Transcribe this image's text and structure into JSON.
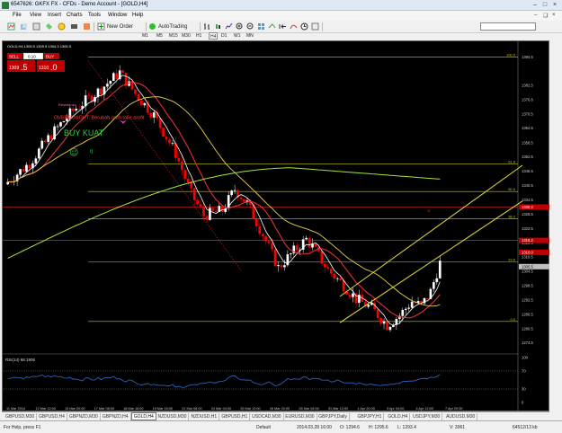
{
  "window": {
    "title": "6547626: GKFX FX - CFDs - Demo Account - [GOLD,H4]"
  },
  "menu": [
    "File",
    "View",
    "Insert",
    "Charts",
    "Tools",
    "Window",
    "Help"
  ],
  "toolbar": {
    "new_order": "New Order",
    "autotrading": "AutoTrading",
    "timeframes": [
      "M1",
      "M5",
      "M15",
      "M30",
      "H1",
      "H4",
      "D1",
      "W1",
      "MN"
    ]
  },
  "chart": {
    "symbol_line": "GOLD,H4 1305.5 1309.9 1304.3 1305.5",
    "sell_label": "SELL",
    "buy_label": "BUY",
    "lot": "0.10",
    "sell_price_big": "1309",
    "sell_price_small": ".5",
    "buy_price_big": "1310",
    "buy_price_small": ".0",
    "annotation_1": "OVERBOUGHT, Berubah arah take profit",
    "annotation_small": "Resistance",
    "annotation_2": "BUY KUAT",
    "rsi_label": "RSI(14) 68.1906",
    "fib_labels": [
      "100.0",
      "61.8",
      "50.0",
      "38.2",
      "23.6",
      "0.0"
    ],
    "price_ticks": [
      "1394.5",
      "1382.5",
      "1376.6",
      "1370.5",
      "1364.6",
      "1358.5",
      "1352.5",
      "1346.5",
      "1340.5",
      "1334.5",
      "1328.5",
      "1322.5",
      "1316.5",
      "1310.5",
      "1304.5",
      "1298.5",
      "1292.5",
      "1286.5",
      "1280.5",
      "1274.5"
    ],
    "rsi_ticks": [
      "100",
      "70",
      "30",
      "0"
    ],
    "highlight_prices": [
      "1330.2",
      "1316.2",
      "1310.0",
      "1305.5"
    ],
    "date_ticks": [
      "11 Mar 2014",
      "12 Mar 12:00",
      "13 Mar 20:00",
      "17 Mar 08:00",
      "18 Mar 16:00",
      "19 Mar 16:00",
      "21 Mar 08:00",
      "24 Mar 04:00",
      "25 Mar 12:00",
      "26 Mar 20:00",
      "28 Mar 04:00",
      "31 Mar 12:00",
      "1 Apr 20:00",
      "3 Apr 04:00",
      "4 Apr 12:00",
      "7 Apr 20:00"
    ]
  },
  "tabs": [
    "GBPUSD,M30",
    "GBPUSD,H4",
    "GBPNZD,M30",
    "GBPNZD,H4",
    "GOLD,H4",
    "NZDUSD,M30",
    "NZDUSD,H1",
    "GBPUSD,H1",
    "USDCAD,M30",
    "EURUSD,M30",
    "GBPJPY,Daily",
    "GBPJPY,H1",
    "GOLD,H4",
    "USDJPY,M30",
    "AUDUSD,M30"
  ],
  "active_tab_index": 4,
  "status": {
    "help": "For Help, press F1",
    "profile": "Default",
    "datetime": "2014.03.28 16:00",
    "open": "O: 1294.6",
    "high": "H: 1295.6",
    "low": "L: 1293.4",
    "volume": "V: 3061",
    "traffic": "64512/13 kb"
  },
  "colors": {
    "bull": "#ffffff",
    "bear": "#ff0000",
    "fib": "#c9c900",
    "ma_yellow": "#e6d24a",
    "ma_green": "#a8e63a",
    "ma_red": "#e0303a",
    "ma_white": "#ffffff",
    "channel": "#e8e03a",
    "rsi": "#2f6fd0"
  }
}
